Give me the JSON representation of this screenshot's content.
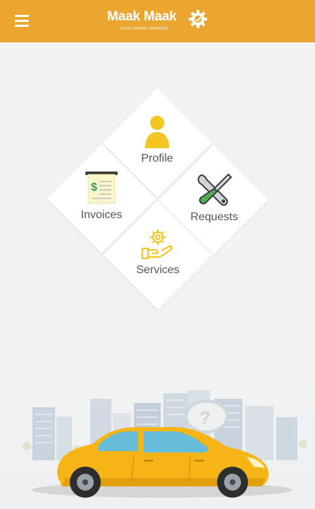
{
  "header": {
    "brand": "Maak Maak",
    "tagline": "AUTO REPAIR SERVICES",
    "bg_color": "#eba630"
  },
  "menu": {
    "icon": "hamburger-menu-icon"
  },
  "tiles": [
    {
      "label": "Profile",
      "icon": "user-icon"
    },
    {
      "label": "Invoices",
      "icon": "receipt-icon"
    },
    {
      "label": "Requests",
      "icon": "tools-icon"
    },
    {
      "label": "Services",
      "icon": "hand-gear-icon"
    }
  ],
  "colors": {
    "accent": "#eba630",
    "icon_yellow": "#f3c623",
    "label_gray": "#555555",
    "car_yellow": "#f6b417"
  }
}
